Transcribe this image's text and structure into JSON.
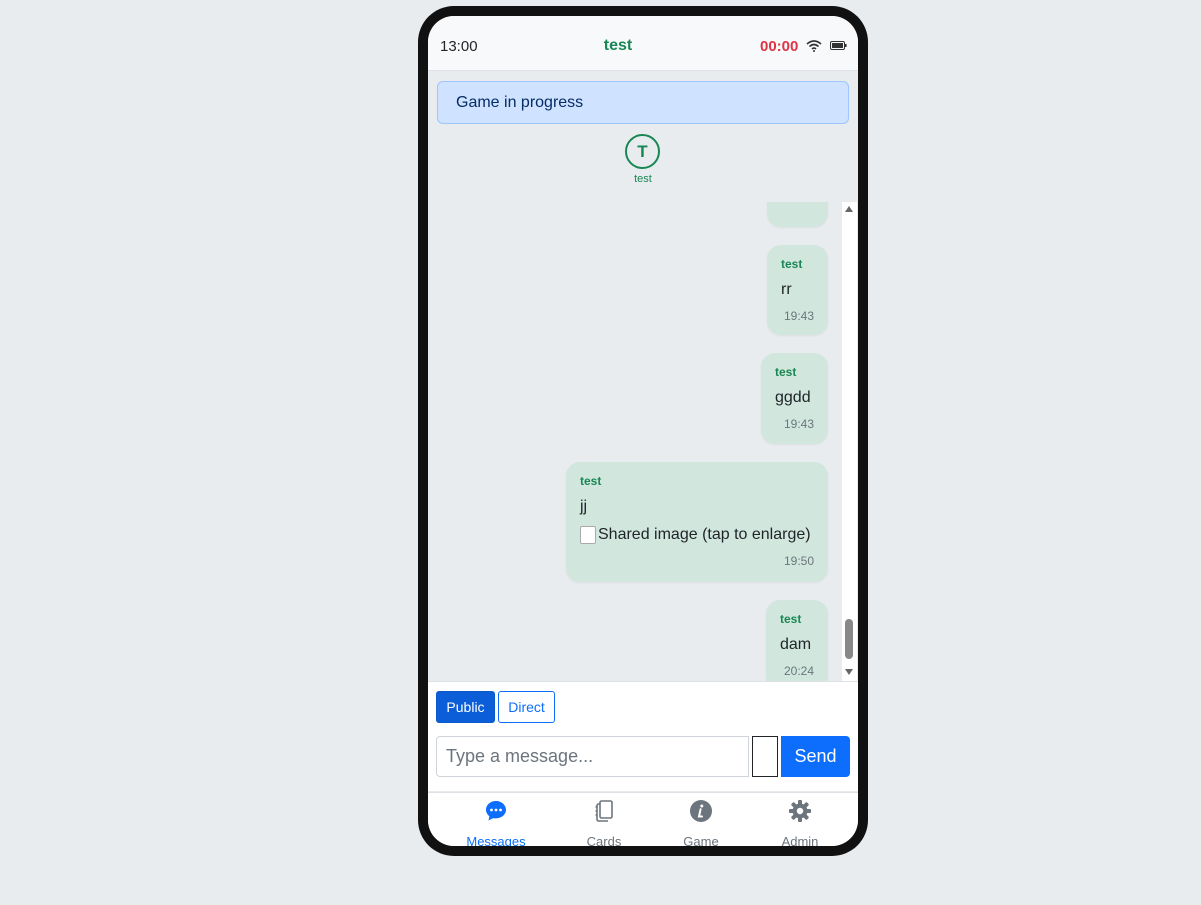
{
  "status_bar": {
    "time": "13:00",
    "title": "test",
    "timer": "00:00"
  },
  "banner": {
    "text": "Game in progress"
  },
  "participant": {
    "initial": "T",
    "name": "test"
  },
  "messages": [
    {
      "sender": "test",
      "text": "rr",
      "time": "19:43"
    },
    {
      "sender": "test",
      "text": "ggdd",
      "time": "19:43"
    },
    {
      "sender": "test",
      "text": "jj",
      "image_alt": "Shared image (tap to enlarge)",
      "time": "19:50"
    },
    {
      "sender": "test",
      "text": "dam",
      "time": "20:24"
    }
  ],
  "composer": {
    "tabs": [
      {
        "label": "Public",
        "active": true
      },
      {
        "label": "Direct",
        "active": false
      }
    ],
    "placeholder": "Type a message...",
    "send_label": "Send"
  },
  "nav": [
    {
      "label": "Messages",
      "icon": "chat-bubble-icon",
      "active": true
    },
    {
      "label": "Cards",
      "icon": "cards-icon",
      "active": false
    },
    {
      "label": "Game",
      "icon": "info-icon",
      "active": false
    },
    {
      "label": "Admin",
      "icon": "gear-icon",
      "active": false
    }
  ],
  "colors": {
    "primary": "#0d6efd",
    "success": "#198754",
    "danger": "#dc3545",
    "bubble": "#d1e7dd",
    "banner": "#cfe2ff"
  }
}
